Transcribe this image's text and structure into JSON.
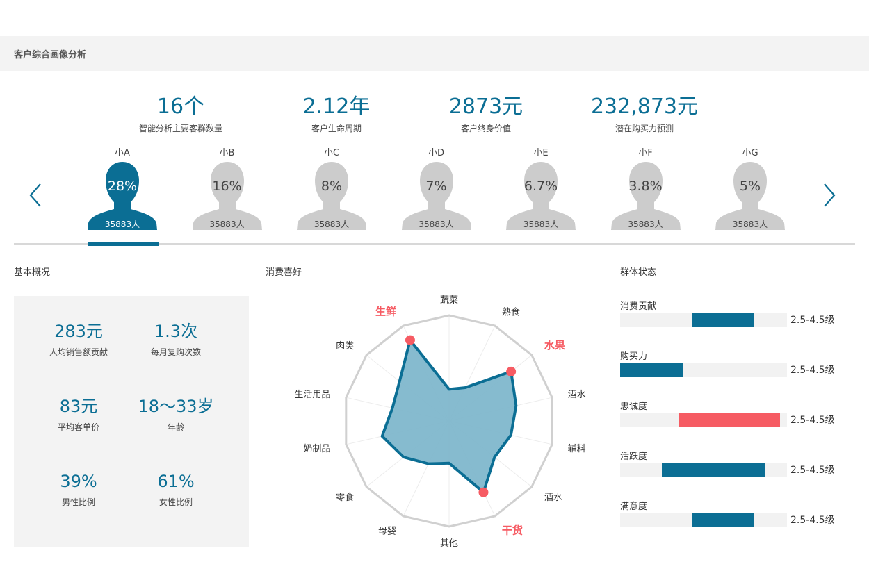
{
  "header": {
    "title": "客户综合画像分析"
  },
  "kpis": [
    {
      "value": "16个",
      "label": "智能分析主要客群数量"
    },
    {
      "value": "2.12年",
      "label": "客户生命周期"
    },
    {
      "value": "2873元",
      "label": "客户终身价值"
    },
    {
      "value": "232,873元",
      "label": "潜在购买力预测"
    }
  ],
  "personas": [
    {
      "name": "小A",
      "percent": "28%",
      "count": "35883人",
      "active": true
    },
    {
      "name": "小B",
      "percent": "16%",
      "count": "35883人",
      "active": false
    },
    {
      "name": "小C",
      "percent": "8%",
      "count": "35883人",
      "active": false
    },
    {
      "name": "小D",
      "percent": "7%",
      "count": "35883人",
      "active": false
    },
    {
      "name": "小E",
      "percent": "6.7%",
      "count": "35883人",
      "active": false
    },
    {
      "name": "小F",
      "percent": "3.8%",
      "count": "35883人",
      "active": false
    },
    {
      "name": "小G",
      "percent": "5%",
      "count": "35883人",
      "active": false
    }
  ],
  "nav": {
    "prev_icon": "chevron-left-icon",
    "next_icon": "chevron-right-icon"
  },
  "overview": {
    "title": "基本概况",
    "stats": [
      {
        "value": "283元",
        "label": "人均销售额贡献"
      },
      {
        "value": "1.3次",
        "label": "每月复购次数"
      },
      {
        "value": "83元",
        "label": "平均客单价"
      },
      {
        "value": "18～33岁",
        "label": "年龄"
      },
      {
        "value": "39%",
        "label": "男性比例"
      },
      {
        "value": "61%",
        "label": "女性比例"
      }
    ]
  },
  "preference": {
    "title": "消费喜好",
    "chart_data": {
      "type": "radar",
      "categories": [
        "蔬菜",
        "熟食",
        "水果",
        "酒水",
        "辅料",
        "酒水",
        "干货",
        "其他",
        "母婴",
        "零食",
        "奶制品",
        "生活用品",
        "肉类",
        "生鲜"
      ],
      "values": [
        0.3,
        0.35,
        0.75,
        0.65,
        0.6,
        0.55,
        0.75,
        0.4,
        0.45,
        0.55,
        0.65,
        0.55,
        0.6,
        0.85
      ],
      "highlighted": [
        "水果",
        "干货",
        "生鲜"
      ],
      "range": [
        0,
        1
      ]
    }
  },
  "group_status": {
    "title": "群体状态",
    "items": [
      {
        "label": "消费贡献",
        "start": 0.43,
        "end": 0.8,
        "value": "2.5-4.5级",
        "highlight": false
      },
      {
        "label": "购买力",
        "start": 0.0,
        "end": 0.375,
        "value": "2.5-4.5级",
        "highlight": false
      },
      {
        "label": "忠诚度",
        "start": 0.35,
        "end": 0.96,
        "value": "2.5-4.5级",
        "highlight": true
      },
      {
        "label": "活跃度",
        "start": 0.25,
        "end": 0.87,
        "value": "2.5-4.5级",
        "highlight": false
      },
      {
        "label": "满意度",
        "start": 0.43,
        "end": 0.8,
        "value": "2.5-4.5级",
        "highlight": false
      }
    ]
  },
  "colors": {
    "primary": "#0b6e94",
    "highlight": "#f65b63",
    "inactive": "#cccccc",
    "radar_fill": "#7fb7cc",
    "grid": "#d0d0d0"
  }
}
